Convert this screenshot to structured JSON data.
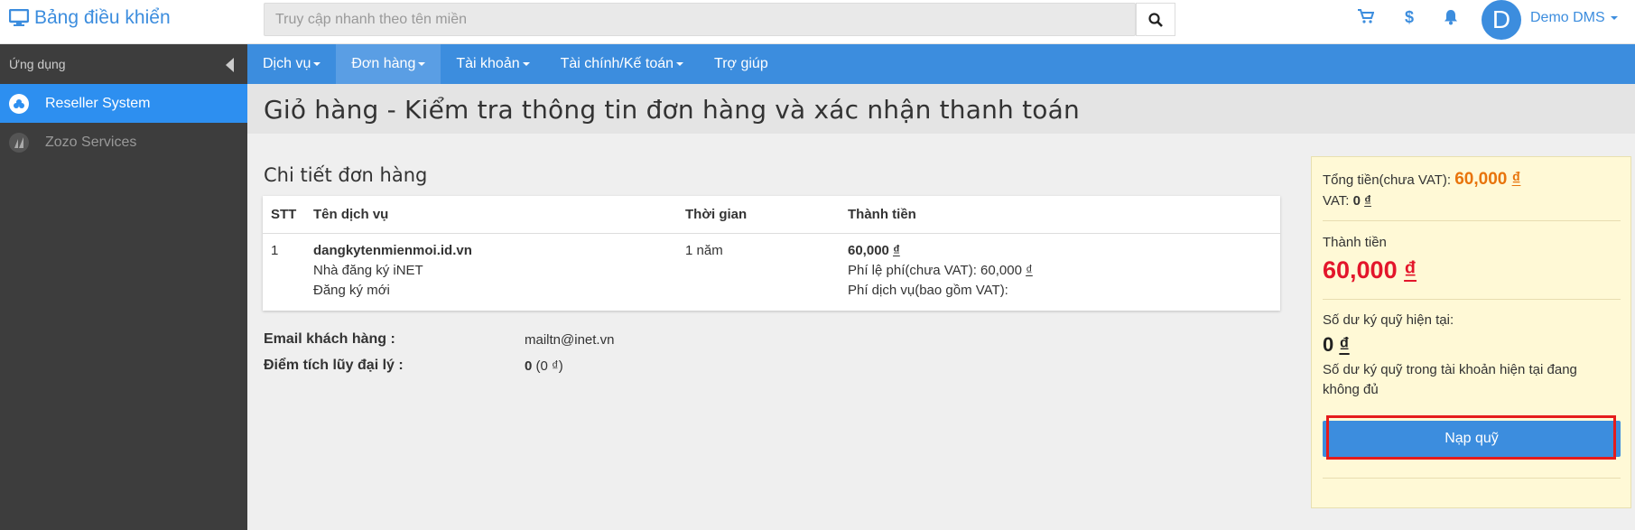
{
  "header": {
    "brand": "Bảng điều khiển",
    "search_placeholder": "Truy cập nhanh theo tên miền",
    "user_initial": "D",
    "user_name": "Demo DMS"
  },
  "sidebar": {
    "heading": "Ứng dụng",
    "items": [
      {
        "label": "Reseller System"
      },
      {
        "label": "Zozo Services"
      }
    ]
  },
  "nav": {
    "items": [
      {
        "label": "Dịch vụ"
      },
      {
        "label": "Đơn hàng"
      },
      {
        "label": "Tài khoản"
      },
      {
        "label": "Tài chính/Kế toán"
      },
      {
        "label": "Trợ giúp"
      }
    ]
  },
  "page": {
    "title": "Giỏ hàng - Kiểm tra thông tin đơn hàng và xác nhận thanh toán",
    "section_title": "Chi tiết đơn hàng"
  },
  "table": {
    "headers": [
      "STT",
      "Tên dịch vụ",
      "Thời gian",
      "Thành tiền"
    ],
    "rows": [
      {
        "stt": "1",
        "domain": "dangkytenmienmoi.id.vn",
        "registrar": "Nhà đăng ký iNET",
        "type": "Đăng ký mới",
        "duration": "1 năm",
        "amount": "60,000",
        "currency": "₫",
        "fee_label": "Phí lệ phí(chưa VAT): 60,000",
        "service_fee_label": "Phí dịch vụ(bao gồm VAT):"
      }
    ]
  },
  "customer": {
    "email_label": "Email khách hàng :",
    "email": "mailtn@inet.vn",
    "points_label": "Điểm tích lũy đại lý :",
    "points": "0",
    "points_detail": "(0 ₫)"
  },
  "summary": {
    "subtotal_label": "Tổng tiền(chưa VAT):",
    "subtotal": "60,000",
    "vat_label": "VAT:",
    "vat": "0",
    "total_label": "Thành tiền",
    "total": "60,000",
    "balance_label": "Số dư ký quỹ hiện tại:",
    "balance": "0",
    "warning": "Số dư ký quỹ trong tài khoản hiện tại đang không đủ",
    "currency": "₫",
    "fund_button": "Nạp quỹ"
  },
  "colors": {
    "accent": "#3c8dde",
    "sidebar_bg": "#3d3d3d",
    "active_item": "#2d8ff0",
    "summary_bg": "#fff9d6",
    "total_red": "#e3162b",
    "subtotal_orange": "#e8740c",
    "highlight_box": "#e51c1c"
  }
}
